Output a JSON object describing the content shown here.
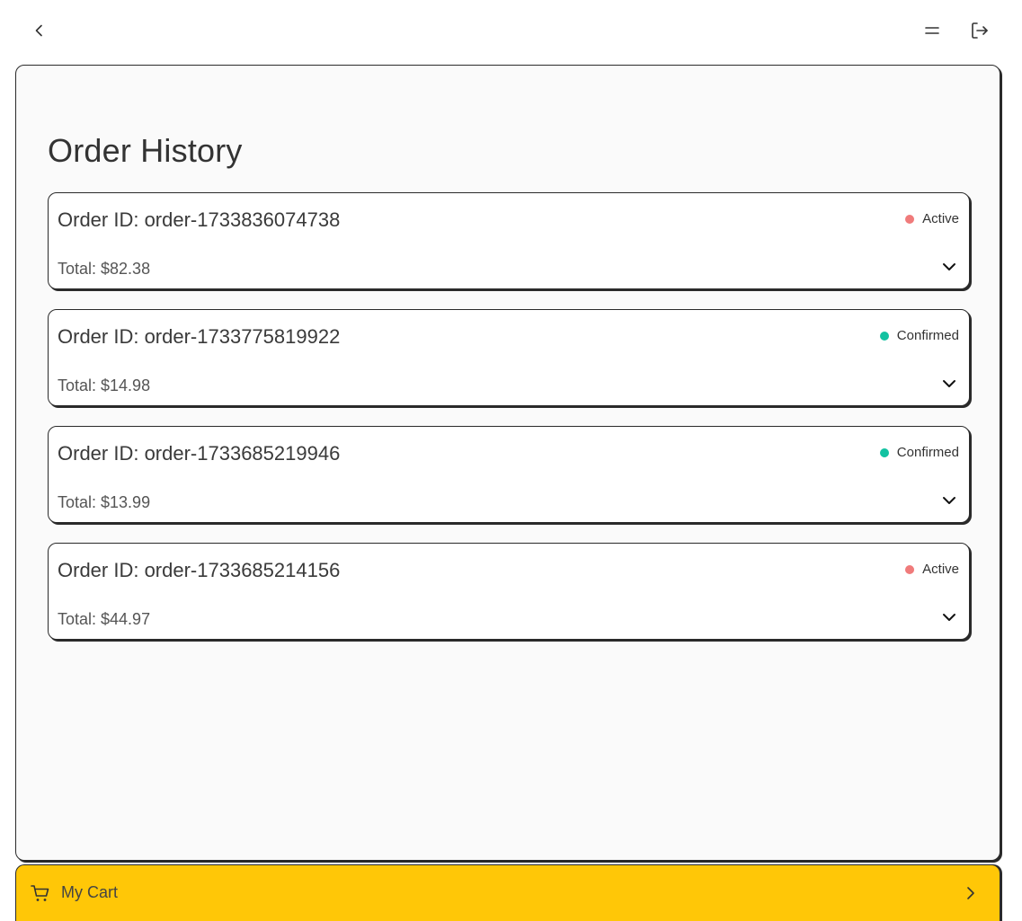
{
  "header": {
    "back_icon": "chevron-left-icon",
    "menu_icon": "menu-icon",
    "logout_icon": "logout-icon"
  },
  "page": {
    "title": "Order History"
  },
  "colors": {
    "active": "#f07b7b",
    "confirmed": "#12c2a1",
    "cart_bar": "#ffc707"
  },
  "orders": [
    {
      "id_label": "Order ID: order-1733836074738",
      "total_label": "Total: $82.38",
      "status": "Active",
      "status_color": "#f07b7b"
    },
    {
      "id_label": "Order ID: order-1733775819922",
      "total_label": "Total: $14.98",
      "status": "Confirmed",
      "status_color": "#12c2a1"
    },
    {
      "id_label": "Order ID: order-1733685219946",
      "total_label": "Total: $13.99",
      "status": "Confirmed",
      "status_color": "#12c2a1"
    },
    {
      "id_label": "Order ID: order-1733685214156",
      "total_label": "Total: $44.97",
      "status": "Active",
      "status_color": "#f07b7b"
    }
  ],
  "cart": {
    "label": "My Cart",
    "icon": "cart-icon"
  }
}
